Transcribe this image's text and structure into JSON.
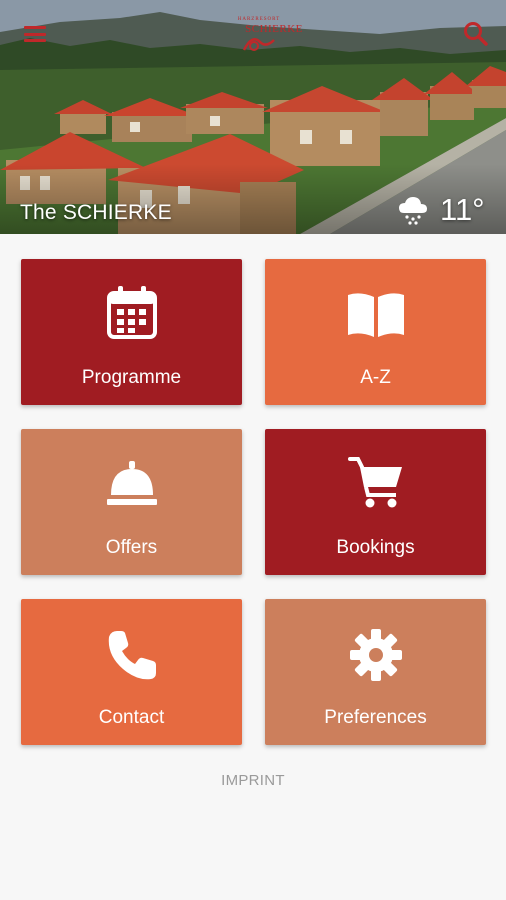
{
  "header": {
    "logo_text": "SCHIERKE",
    "logo_tagline": "HARZRESORT",
    "hotel_name": "The SCHIERKE",
    "weather": {
      "icon": "snow-rain-cloud-icon",
      "temperature": "11°"
    },
    "menu_icon": "hamburger-menu-icon",
    "search_icon": "search-icon"
  },
  "tiles": [
    {
      "label": "Programme",
      "icon": "calendar-icon",
      "color": "#a01c22"
    },
    {
      "label": "A-Z",
      "icon": "open-book-icon",
      "color": "#e66a40"
    },
    {
      "label": "Offers",
      "icon": "service-bell-icon",
      "color": "#cc7f5c"
    },
    {
      "label": "Bookings",
      "icon": "shopping-cart-icon",
      "color": "#a01c22"
    },
    {
      "label": "Contact",
      "icon": "phone-icon",
      "color": "#e66a40"
    },
    {
      "label": "Preferences",
      "icon": "gear-icon",
      "color": "#cc7f5c"
    }
  ],
  "footer": {
    "imprint": "IMPRINT"
  },
  "colors": {
    "accent": "#c0282a",
    "background": "#f7f7f7",
    "footer_text": "#9a9a9a"
  }
}
